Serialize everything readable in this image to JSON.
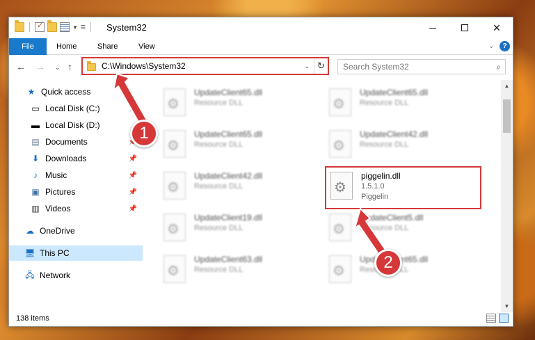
{
  "window": {
    "title": "System32"
  },
  "ribbon": {
    "tabs": [
      "File",
      "Home",
      "Share",
      "View"
    ]
  },
  "address": {
    "path": "C:\\Windows\\System32"
  },
  "search": {
    "placeholder": "Search System32"
  },
  "sidebar": {
    "items": [
      {
        "label": "Quick access",
        "icon": "star-icon"
      },
      {
        "label": "Local Disk (C:)",
        "icon": "drive-icon"
      },
      {
        "label": "Local Disk (D:)",
        "icon": "drive-icon"
      },
      {
        "label": "Documents",
        "icon": "document-icon"
      },
      {
        "label": "Downloads",
        "icon": "download-icon"
      },
      {
        "label": "Music",
        "icon": "music-icon"
      },
      {
        "label": "Pictures",
        "icon": "pictures-icon"
      },
      {
        "label": "Videos",
        "icon": "video-icon"
      },
      {
        "label": "OneDrive",
        "icon": "cloud-icon"
      },
      {
        "label": "This PC",
        "icon": "computer-icon"
      },
      {
        "label": "Network",
        "icon": "network-icon"
      }
    ]
  },
  "files": [
    {
      "name": "UpdateClient65.dll",
      "sub": "Resource DLL"
    },
    {
      "name": "UpdateClient65.dll",
      "sub": "Resource DLL"
    },
    {
      "name": "UpdateClient65.dll",
      "sub": "Resource DLL"
    },
    {
      "name": "UpdateClient42.dll",
      "sub": "Resource DLL"
    },
    {
      "name": "UpdateClient42.dll",
      "sub": "Resource DLL"
    },
    {
      "name": "piggelin.dll",
      "version": "1.5.1.0",
      "company": "Piggelin"
    },
    {
      "name": "UpdateClient19.dll",
      "sub": "Resource DLL"
    },
    {
      "name": "UpdateClient5.dll",
      "sub": "Resource DLL"
    },
    {
      "name": "UpdateClient63.dll",
      "sub": "Resource DLL"
    },
    {
      "name": "UpdateClient65.dll",
      "sub": "Resource DLL"
    }
  ],
  "status": {
    "count": "138 items"
  },
  "annotations": {
    "step1": "1",
    "step2": "2",
    "accent": "#d6383a"
  }
}
